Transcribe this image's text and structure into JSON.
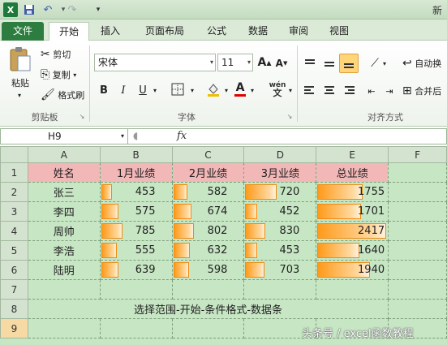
{
  "window": {
    "title": "新"
  },
  "quick_access": {
    "logo": "X"
  },
  "tabs": {
    "file": "文件",
    "home": "开始",
    "insert": "插入",
    "layout": "页面布局",
    "formula": "公式",
    "data": "数据",
    "review": "审阅",
    "view": "视图"
  },
  "ribbon": {
    "paste": "粘贴",
    "cut": "剪切",
    "copy": "复制",
    "format_painter": "格式刷",
    "clipboard_label": "剪贴板",
    "font_name": "宋体",
    "font_size": "11",
    "bold": "B",
    "italic": "I",
    "underline": "U",
    "font_color_glyph": "A",
    "font_label": "字体",
    "wrap_text": "自动换",
    "merge": "合并后",
    "align_label": "对齐方式"
  },
  "formula_bar": {
    "name_box": "H9",
    "fx": "fx"
  },
  "columns": [
    "A",
    "B",
    "C",
    "D",
    "E",
    "F"
  ],
  "headers": [
    "姓名",
    "1月业绩",
    "2月业绩",
    "3月业绩",
    "总业绩"
  ],
  "rows": [
    {
      "name": "张三",
      "m1": "453",
      "m2": "582",
      "m3": "720",
      "total": "1755",
      "b1": 0.15,
      "b2": 0.2,
      "b3": 0.45,
      "bt": 0.65
    },
    {
      "name": "李四",
      "m1": "575",
      "m2": "674",
      "m3": "452",
      "total": "1701",
      "b1": 0.25,
      "b2": 0.26,
      "b3": 0.17,
      "bt": 0.62
    },
    {
      "name": "周帅",
      "m1": "785",
      "m2": "802",
      "m3": "830",
      "total": "2417",
      "b1": 0.3,
      "b2": 0.3,
      "b3": 0.28,
      "bt": 0.99
    },
    {
      "name": "李浩",
      "m1": "555",
      "m2": "632",
      "m3": "453",
      "total": "1640",
      "b1": 0.22,
      "b2": 0.24,
      "b3": 0.17,
      "bt": 0.6
    },
    {
      "name": "陆明",
      "m1": "639",
      "m2": "598",
      "m3": "703",
      "total": "1940",
      "b1": 0.25,
      "b2": 0.23,
      "b3": 0.27,
      "bt": 0.75
    }
  ],
  "row_numbers": [
    "1",
    "2",
    "3",
    "4",
    "5",
    "6",
    "7",
    "8",
    "9"
  ],
  "note": "选择范围-开始-条件格式-数据条",
  "watermark": "头条号 / excel函数教程"
}
